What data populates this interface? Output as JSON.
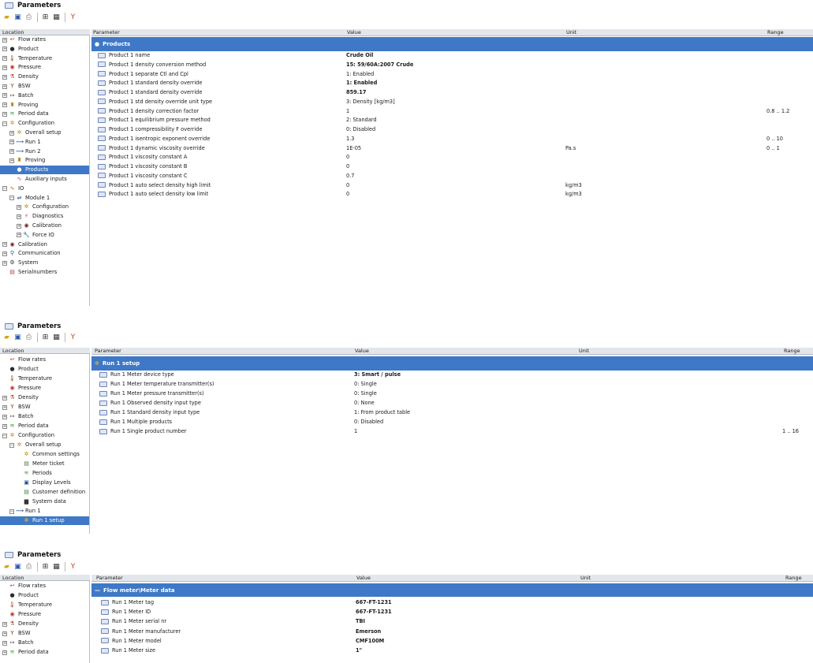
{
  "window_title": "Parameters",
  "columns": {
    "location": "Location",
    "parameter": "Parameter",
    "value": "Value",
    "unit": "Unit",
    "range": "Range"
  },
  "panel1": {
    "tree": [
      {
        "label": "Flow rates",
        "icon": "flow-icon",
        "glyph": "↩",
        "color": "#c2401a",
        "toggle": "+",
        "indent": 0
      },
      {
        "label": "Product",
        "icon": "drop-icon",
        "glyph": "●",
        "color": "#2b2b2b",
        "toggle": "+",
        "indent": 0
      },
      {
        "label": "Temperature",
        "icon": "thermometer-icon",
        "glyph": "🌡",
        "color": "#b5402a",
        "toggle": "+",
        "indent": 0
      },
      {
        "label": "Pressure",
        "icon": "pressure-gauge-icon",
        "glyph": "◉",
        "color": "#c0392b",
        "toggle": "+",
        "indent": 0
      },
      {
        "label": "Density",
        "icon": "density-icon",
        "glyph": "⚗",
        "color": "#a0522d",
        "toggle": "+",
        "indent": 0
      },
      {
        "label": "BSW",
        "icon": "funnel-icon",
        "glyph": "Y",
        "color": "#7a3b10",
        "toggle": "+",
        "indent": 0
      },
      {
        "label": "Batch",
        "icon": "batch-icon",
        "glyph": "↦",
        "color": "#555555",
        "toggle": "+",
        "indent": 0
      },
      {
        "label": "Proving",
        "icon": "prover-icon",
        "glyph": "♜",
        "color": "#b07a10",
        "toggle": "+",
        "indent": 0
      },
      {
        "label": "Period data",
        "icon": "period-icon",
        "glyph": "≋",
        "color": "#3a9a3a",
        "toggle": "+",
        "indent": 0
      },
      {
        "label": "Configuration",
        "icon": "config-icon",
        "glyph": "✲",
        "color": "#c08a10",
        "toggle": "−",
        "indent": 0
      },
      {
        "label": "Overall setup",
        "icon": "config-icon",
        "glyph": "✲",
        "color": "#c08a10",
        "toggle": "+",
        "indent": 1
      },
      {
        "label": "Run 1",
        "icon": "run-icon",
        "glyph": "⟿",
        "color": "#1f4f8f",
        "toggle": "+",
        "indent": 1
      },
      {
        "label": "Run 2",
        "icon": "run-icon",
        "glyph": "⟿",
        "color": "#1f4f8f",
        "toggle": "+",
        "indent": 1
      },
      {
        "label": "Proving",
        "icon": "prover-icon",
        "glyph": "♜",
        "color": "#b07a10",
        "toggle": "+",
        "indent": 1
      },
      {
        "label": "Products",
        "icon": "drop-icon",
        "glyph": "●",
        "color": "#ffffff",
        "toggle": "",
        "indent": 1,
        "selected": true
      },
      {
        "label": "Auxiliary inputs",
        "icon": "wave-icon",
        "glyph": "∿",
        "color": "#c2401a",
        "toggle": "",
        "indent": 1
      },
      {
        "label": "IO",
        "icon": "io-icon",
        "glyph": "∿",
        "color": "#c2401a",
        "toggle": "−",
        "indent": 0
      },
      {
        "label": "Module 1",
        "icon": "module-icon",
        "glyph": "⇌",
        "color": "#1f4f8f",
        "toggle": "−",
        "indent": 1
      },
      {
        "label": "Configuration",
        "icon": "config-icon",
        "glyph": "✲",
        "color": "#c08a10",
        "toggle": "+",
        "indent": 2
      },
      {
        "label": "Diagnostics",
        "icon": "diagnostics-icon",
        "glyph": "⚡",
        "color": "#c0392b",
        "toggle": "+",
        "indent": 2
      },
      {
        "label": "Calibration",
        "icon": "calibration-icon",
        "glyph": "◉",
        "color": "#7a1f1f",
        "toggle": "+",
        "indent": 2
      },
      {
        "label": "Force IO",
        "icon": "wrench-icon",
        "glyph": "🔧",
        "color": "#1f4f8f",
        "toggle": "+",
        "indent": 2
      },
      {
        "label": "Calibration",
        "icon": "calibration-icon",
        "glyph": "◉",
        "color": "#7a1f1f",
        "toggle": "+",
        "indent": 0
      },
      {
        "label": "Communication",
        "icon": "network-icon",
        "glyph": "⚲",
        "color": "#1f4f8f",
        "toggle": "+",
        "indent": 0
      },
      {
        "label": "System",
        "icon": "gear-icon",
        "glyph": "⚙",
        "color": "#333333",
        "toggle": "+",
        "indent": 0
      },
      {
        "label": "Serialnumbers",
        "icon": "serial-icon",
        "glyph": "▤",
        "color": "#b04040",
        "toggle": "",
        "indent": 0
      }
    ],
    "section": "Products",
    "section_icon": "drop-icon",
    "rows": [
      {
        "parameter": "Product 1 name",
        "value": "Crude Oil",
        "unit": "",
        "range": "",
        "bold": true
      },
      {
        "parameter": "Product 1 density conversion method",
        "value": "15: 59/60A:2007 Crude",
        "unit": "",
        "range": "",
        "bold": true
      },
      {
        "parameter": "Product 1 separate Ctl and Cpl",
        "value": "1: Enabled",
        "unit": "",
        "range": "",
        "bold": false
      },
      {
        "parameter": "Product 1 standard density override",
        "value": "1: Enabled",
        "unit": "",
        "range": "",
        "bold": true
      },
      {
        "parameter": "Product 1 standard density override",
        "value": "859.17",
        "unit": "",
        "range": "",
        "bold": true
      },
      {
        "parameter": "Product 1 std density override unit type",
        "value": "3: Density [kg/m3]",
        "unit": "",
        "range": "",
        "bold": false
      },
      {
        "parameter": "Product 1 density correction factor",
        "value": "1",
        "unit": "",
        "range": "0.8 .. 1.2",
        "bold": false
      },
      {
        "parameter": "Product 1 equilibrium pressure method",
        "value": "2: Standard",
        "unit": "",
        "range": "",
        "bold": false
      },
      {
        "parameter": "Product 1 compressibility F override",
        "value": "0: Disabled",
        "unit": "",
        "range": "",
        "bold": false
      },
      {
        "parameter": "Product 1 isentropic exponent override",
        "value": "1.3",
        "unit": "",
        "range": "0 .. 10",
        "bold": false
      },
      {
        "parameter": "Product 1 dynamic viscosity override",
        "value": "1E-05",
        "unit": "Pa.s",
        "range": "0 .. 1",
        "bold": false
      },
      {
        "parameter": "Product 1 viscosity constant A",
        "value": "0",
        "unit": "",
        "range": "",
        "bold": false
      },
      {
        "parameter": "Product 1 viscosity constant B",
        "value": "0",
        "unit": "",
        "range": "",
        "bold": false
      },
      {
        "parameter": "Product 1 viscosity constant C",
        "value": "0.7",
        "unit": "",
        "range": "",
        "bold": false
      },
      {
        "parameter": "Product 1 auto select density high limit",
        "value": "0",
        "unit": "kg/m3",
        "range": "",
        "bold": false
      },
      {
        "parameter": "Product 1 auto select density low limit",
        "value": "0",
        "unit": "kg/m3",
        "range": "",
        "bold": false
      }
    ]
  },
  "panel2": {
    "tree": [
      {
        "label": "Flow rates",
        "icon": "flow-icon",
        "glyph": "↩",
        "color": "#c2401a",
        "toggle": "",
        "indent": 0
      },
      {
        "label": "Product",
        "icon": "drop-icon",
        "glyph": "●",
        "color": "#2b2b2b",
        "toggle": "",
        "indent": 0
      },
      {
        "label": "Temperature",
        "icon": "thermometer-icon",
        "glyph": "🌡",
        "color": "#b5402a",
        "toggle": "",
        "indent": 0
      },
      {
        "label": "Pressure",
        "icon": "pressure-gauge-icon",
        "glyph": "◉",
        "color": "#c0392b",
        "toggle": "",
        "indent": 0
      },
      {
        "label": "Density",
        "icon": "density-icon",
        "glyph": "⚗",
        "color": "#a0522d",
        "toggle": "+",
        "indent": 0
      },
      {
        "label": "BSW",
        "icon": "funnel-icon",
        "glyph": "Y",
        "color": "#7a3b10",
        "toggle": "+",
        "indent": 0
      },
      {
        "label": "Batch",
        "icon": "batch-icon",
        "glyph": "↦",
        "color": "#555555",
        "toggle": "+",
        "indent": 0
      },
      {
        "label": "Period data",
        "icon": "period-icon",
        "glyph": "≋",
        "color": "#3a9a3a",
        "toggle": "+",
        "indent": 0
      },
      {
        "label": "Configuration",
        "icon": "config-icon",
        "glyph": "✲",
        "color": "#c08a10",
        "toggle": "−",
        "indent": 0
      },
      {
        "label": "Overall setup",
        "icon": "config-icon",
        "glyph": "✲",
        "color": "#c08a10",
        "toggle": "−",
        "indent": 1
      },
      {
        "label": "Common settings",
        "icon": "settings-icon",
        "glyph": "✲",
        "color": "#c08a10",
        "toggle": "",
        "indent": 2
      },
      {
        "label": "Meter ticket",
        "icon": "ticket-icon",
        "glyph": "▤",
        "color": "#3a7a3a",
        "toggle": "",
        "indent": 2
      },
      {
        "label": "Periods",
        "icon": "period-icon",
        "glyph": "≋",
        "color": "#3a9a3a",
        "toggle": "",
        "indent": 2
      },
      {
        "label": "Display Levels",
        "icon": "display-icon",
        "glyph": "▣",
        "color": "#1f4f8f",
        "toggle": "",
        "indent": 2
      },
      {
        "label": "Customer definition",
        "icon": "customer-icon",
        "glyph": "▤",
        "color": "#3a7a3a",
        "toggle": "",
        "indent": 2
      },
      {
        "label": "System data",
        "icon": "system-data-icon",
        "glyph": "▆",
        "color": "#333333",
        "toggle": "",
        "indent": 2
      },
      {
        "label": "Run 1",
        "icon": "run-icon",
        "glyph": "⟿",
        "color": "#1f4f8f",
        "toggle": "−",
        "indent": 1
      },
      {
        "label": "Run 1 setup",
        "icon": "config-icon",
        "glyph": "✲",
        "color": "#f0c040",
        "toggle": "",
        "indent": 2,
        "selected": true
      }
    ],
    "section": "Run 1 setup",
    "section_icon": "config-icon",
    "rows": [
      {
        "parameter": "Run 1 Meter device type",
        "value": "3: Smart / pulse",
        "unit": "",
        "range": "",
        "bold": true
      },
      {
        "parameter": "Run 1 Meter temperature transmitter(s)",
        "value": "0: Single",
        "unit": "",
        "range": "",
        "bold": false
      },
      {
        "parameter": "Run 1 Meter pressure transmitter(s)",
        "value": "0: Single",
        "unit": "",
        "range": "",
        "bold": false
      },
      {
        "parameter": "Run 1 Observed density input type",
        "value": "0: None",
        "unit": "",
        "range": "",
        "bold": false
      },
      {
        "parameter": "Run 1 Standard density input type",
        "value": "1: From product table",
        "unit": "",
        "range": "",
        "bold": false
      },
      {
        "parameter": "Run 1 Multiple products",
        "value": "0: Disabled",
        "unit": "",
        "range": "",
        "bold": false
      },
      {
        "parameter": "Run 1 Single product number",
        "value": "1",
        "unit": "",
        "range": "1 .. 16",
        "bold": false
      }
    ]
  },
  "panel3": {
    "tree": [
      {
        "label": "Flow rates",
        "icon": "flow-icon",
        "glyph": "↩",
        "color": "#c2401a",
        "toggle": "",
        "indent": 0
      },
      {
        "label": "Product",
        "icon": "drop-icon",
        "glyph": "●",
        "color": "#2b2b2b",
        "toggle": "",
        "indent": 0
      },
      {
        "label": "Temperature",
        "icon": "thermometer-icon",
        "glyph": "🌡",
        "color": "#b5402a",
        "toggle": "",
        "indent": 0
      },
      {
        "label": "Pressure",
        "icon": "pressure-gauge-icon",
        "glyph": "◉",
        "color": "#c0392b",
        "toggle": "",
        "indent": 0
      },
      {
        "label": "Density",
        "icon": "density-icon",
        "glyph": "⚗",
        "color": "#a0522d",
        "toggle": "+",
        "indent": 0
      },
      {
        "label": "BSW",
        "icon": "funnel-icon",
        "glyph": "Y",
        "color": "#7a3b10",
        "toggle": "+",
        "indent": 0
      },
      {
        "label": "Batch",
        "icon": "batch-icon",
        "glyph": "↦",
        "color": "#555555",
        "toggle": "+",
        "indent": 0
      },
      {
        "label": "Period data",
        "icon": "period-icon",
        "glyph": "≋",
        "color": "#3a9a3a",
        "toggle": "+",
        "indent": 0
      }
    ],
    "section": "Flow meter\\Meter data",
    "section_icon": "meter-icon",
    "rows": [
      {
        "parameter": "Run 1 Meter tag",
        "value": "667-FT-1231",
        "unit": "",
        "range": "",
        "bold": true
      },
      {
        "parameter": "Run 1 Meter ID",
        "value": "667-FT-1231",
        "unit": "",
        "range": "",
        "bold": true
      },
      {
        "parameter": "Run 1 Meter serial nr",
        "value": "TBI",
        "unit": "",
        "range": "",
        "bold": true
      },
      {
        "parameter": "Run 1 Meter manufacturer",
        "value": "Emerson",
        "unit": "",
        "range": "",
        "bold": true
      },
      {
        "parameter": "Run 1 Meter model",
        "value": "CMF100M",
        "unit": "",
        "range": "",
        "bold": true
      },
      {
        "parameter": "Run 1 Meter size",
        "value": "1\"",
        "unit": "",
        "range": "",
        "bold": true
      }
    ]
  }
}
